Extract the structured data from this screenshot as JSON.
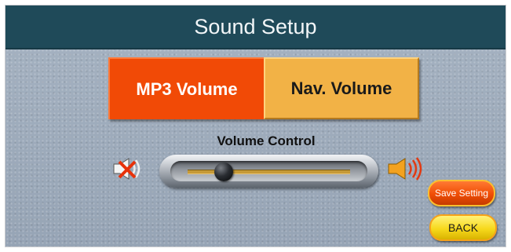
{
  "window": {
    "title": "Sound Setup"
  },
  "tabs": [
    {
      "label": "MP3 Volume",
      "active": true,
      "color": "#f14a06"
    },
    {
      "label": "Nav. Volume",
      "active": false,
      "color": "#f2b246"
    }
  ],
  "volume": {
    "label": "Volume Control",
    "level_fraction": 0.22,
    "min_icon": "speaker-muted-icon",
    "max_icon": "speaker-loud-icon"
  },
  "buttons": {
    "save_label": "Save Setting",
    "back_label": "BACK"
  },
  "colors": {
    "title_bar": "#1f4a59",
    "background": "#9aa8b9",
    "save_button": "#f04d05",
    "back_button": "#f7d91c"
  }
}
